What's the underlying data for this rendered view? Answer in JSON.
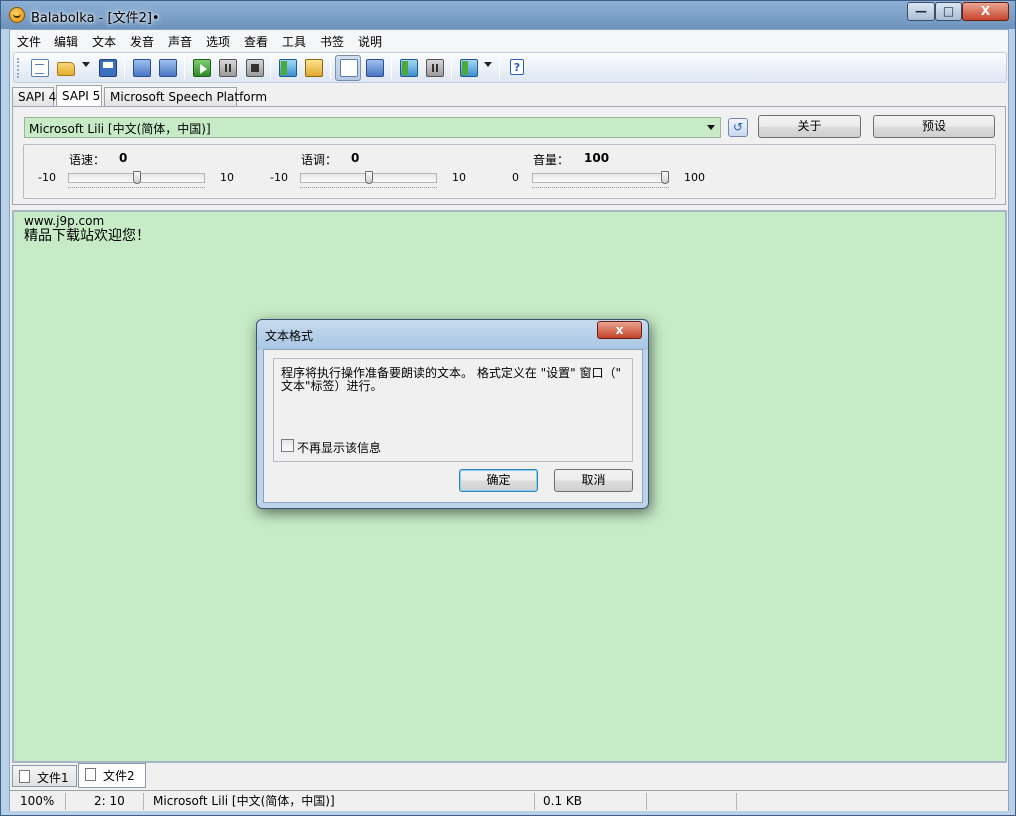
{
  "window": {
    "title": "Balabolka - [文件2]•",
    "min_glyph": "—",
    "max_glyph": "□",
    "close_glyph": "X"
  },
  "menu": {
    "items": [
      "文件",
      "编辑",
      "文本",
      "发音",
      "声音",
      "选项",
      "查看",
      "工具",
      "书签",
      "说明"
    ]
  },
  "toolbar": {
    "help_glyph": "?"
  },
  "engine_tabs": [
    "SAPI 4",
    "SAPI 5",
    "Microsoft Speech Platform"
  ],
  "engine": {
    "voice": "Microsoft Lili [中文(简体，中国)]",
    "refresh_glyph": "↺",
    "about_label": "关于",
    "preset_label": "预设"
  },
  "sliders": {
    "rate": {
      "label": "语速：",
      "value": "0",
      "min": "-10",
      "max": "10",
      "level": 0.5
    },
    "pitch": {
      "label": "语调：",
      "value": "0",
      "min": "-10",
      "max": "10",
      "level": 0.5
    },
    "volume": {
      "label": "音量：",
      "value": "100",
      "min": "0",
      "max": "100",
      "level": 1.0
    }
  },
  "editor": {
    "lines": [
      "www.j9p.com",
      "精品下载站欢迎您！"
    ],
    "bg_color": "#c6ebc6"
  },
  "doc_tabs": [
    "文件1",
    "文件2"
  ],
  "status": {
    "zoom": "100%",
    "position": "2:  10",
    "voice": "Microsoft Lili [中文(简体，中国)]",
    "size": "0.1 KB"
  },
  "dialog": {
    "title": "文本格式",
    "close_glyph": "x",
    "message": "程序将执行操作准备要朗读的文本。 格式定义在 \"设置\" 窗口（\" 文本\"标签）进行。",
    "checkbox_label": "不再显示该信息",
    "checkbox_checked": false,
    "ok_label": "确定",
    "cancel_label": "取消"
  }
}
